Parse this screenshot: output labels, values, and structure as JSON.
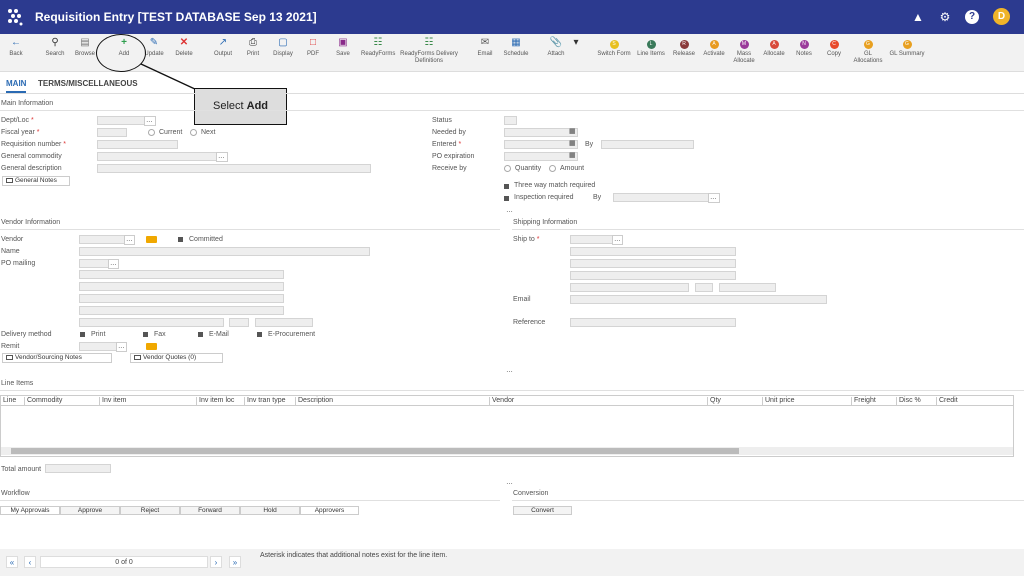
{
  "app": {
    "title": "Requisition Entry [TEST DATABASE Sep 13 2021]",
    "avatar_letter": "D",
    "icons": [
      "logo-icon",
      "graduation-cap-icon",
      "gear-icon",
      "help-icon"
    ]
  },
  "toolbar": {
    "back": "Back",
    "search": "Search",
    "browse": "Browse",
    "add": "Add",
    "update": "Update",
    "delete": "Delete",
    "output": "Output",
    "print": "Print",
    "display": "Display",
    "pdf": "PDF",
    "save": "Save",
    "readyforms": "ReadyForms",
    "readyforms_delivery": "ReadyForms Delivery Definitions",
    "email": "Email",
    "schedule": "Schedule",
    "attach": "Attach",
    "switch_form": "Switch Form",
    "line_items": "Line Items",
    "release": "Release",
    "activate": "Activate",
    "mass_allocate": "Mass Allocate",
    "allocate": "Allocate",
    "notes": "Notes",
    "copy": "Copy",
    "gl_allocations": "GL Allocations",
    "gl_summary": "GL Summary"
  },
  "callout": {
    "prefix": "Select ",
    "bold": "Add"
  },
  "tabs": {
    "main": "MAIN",
    "terms": "TERMS/MISCELLANEOUS"
  },
  "main_info": {
    "heading": "Main Information",
    "dept_loc": "Dept/Loc",
    "fiscal_year": "Fiscal year",
    "current": "Current",
    "next": "Next",
    "requisition_number": "Requisition number",
    "general_commodity": "General commodity",
    "general_description": "General description",
    "general_notes": "General Notes",
    "status": "Status",
    "needed_by": "Needed by",
    "entered": "Entered",
    "by": "By",
    "po_expiration": "PO expiration",
    "receive_by": "Receive by",
    "quantity": "Quantity",
    "amount": "Amount",
    "three_way": "Three way match required",
    "inspection": "Inspection required",
    "by2": "By",
    "asterisk": "*"
  },
  "vendor_info": {
    "heading": "Vendor Information",
    "vendor": "Vendor",
    "committed": "Committed",
    "name": "Name",
    "po_mailing": "PO mailing",
    "delivery_method": "Delivery method",
    "print": "Print",
    "fax": "Fax",
    "email": "E-Mail",
    "eprocurement": "E-Procurement",
    "remit": "Remit",
    "vendor_notes": "Vendor/Sourcing Notes",
    "vendor_quotes": "Vendor Quotes (0)"
  },
  "shipping_info": {
    "heading": "Shipping Information",
    "ship_to": "Ship to",
    "email": "Email",
    "reference": "Reference"
  },
  "line_items": {
    "heading": "Line Items",
    "columns": [
      "Line",
      "Commodity",
      "Inv item",
      "Inv item loc",
      "Inv tran type",
      "Description",
      "Vendor",
      "Qty",
      "Unit price",
      "Freight",
      "Disc %",
      "Credit"
    ]
  },
  "totals": {
    "total_amount": "Total amount"
  },
  "workflow": {
    "heading": "Workflow",
    "buttons": [
      "My Approvals",
      "Approve",
      "Reject",
      "Forward",
      "Hold",
      "Approvers"
    ]
  },
  "conversion": {
    "heading": "Conversion",
    "convert": "Convert"
  },
  "footer": {
    "page": "0 of 0",
    "note": "Asterisk indicates that additional notes exist for the line item."
  },
  "colors": {
    "titlebar": "#2c3a8f",
    "accent": "#2a6ab3",
    "avatar": "#f0b429",
    "folder": "#f0a800"
  }
}
